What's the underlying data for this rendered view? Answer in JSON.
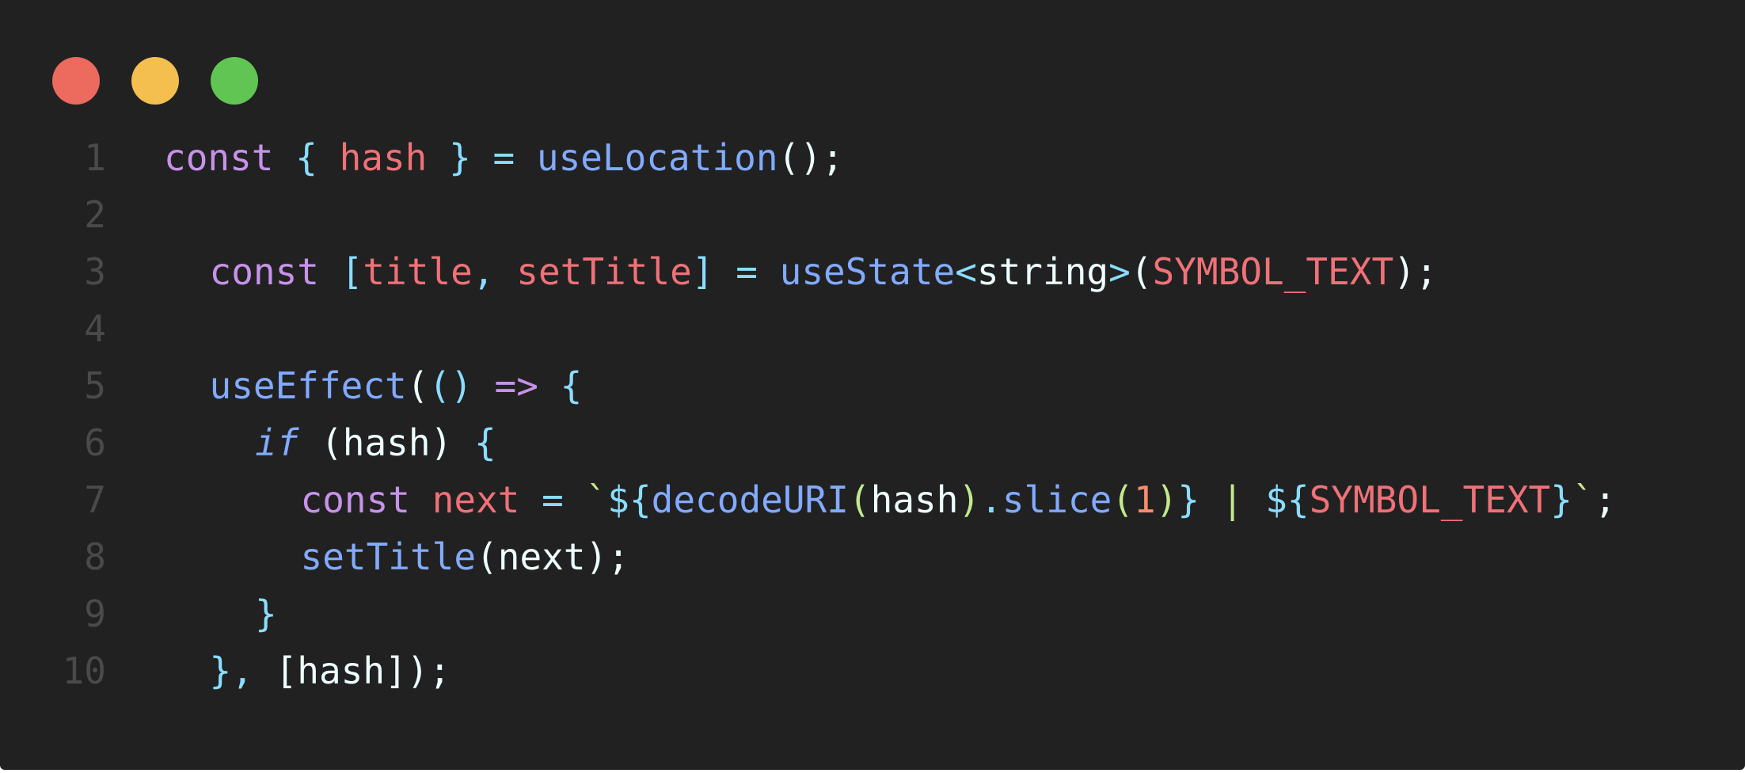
{
  "window": {
    "traffic_lights": [
      {
        "name": "close-dot",
        "color": "#ed6a5e"
      },
      {
        "name": "minimize-dot",
        "color": "#f5bf4f"
      },
      {
        "name": "maximize-dot",
        "color": "#61c554"
      }
    ]
  },
  "colors": {
    "background": "#212121",
    "keyword": "#c792ea",
    "variable": "#f07178",
    "function": "#82aaff",
    "punctuation": "#89ddff",
    "plain": "#eeffff",
    "number": "#f78c6c",
    "paren_inner": "#c3e88d",
    "line_number": "#4a4a4a"
  },
  "code": {
    "lines": [
      {
        "num": "1",
        "indent": 0,
        "tokens": [
          {
            "t": "const",
            "c": "keyword"
          },
          {
            "t": " ",
            "c": "plain"
          },
          {
            "t": "{",
            "c": "punctuation"
          },
          {
            "t": " ",
            "c": "plain"
          },
          {
            "t": "hash",
            "c": "variable"
          },
          {
            "t": " ",
            "c": "plain"
          },
          {
            "t": "}",
            "c": "punctuation"
          },
          {
            "t": " ",
            "c": "plain"
          },
          {
            "t": "=",
            "c": "punctuation"
          },
          {
            "t": " ",
            "c": "plain"
          },
          {
            "t": "useLocation",
            "c": "function"
          },
          {
            "t": "();",
            "c": "plain"
          }
        ]
      },
      {
        "num": "2",
        "indent": 0,
        "tokens": []
      },
      {
        "num": "3",
        "indent": 1,
        "tokens": [
          {
            "t": "const",
            "c": "keyword"
          },
          {
            "t": " ",
            "c": "plain"
          },
          {
            "t": "[",
            "c": "punctuation"
          },
          {
            "t": "title",
            "c": "variable"
          },
          {
            "t": ",",
            "c": "punctuation"
          },
          {
            "t": " ",
            "c": "plain"
          },
          {
            "t": "setTitle",
            "c": "variable"
          },
          {
            "t": "]",
            "c": "punctuation"
          },
          {
            "t": " ",
            "c": "plain"
          },
          {
            "t": "=",
            "c": "punctuation"
          },
          {
            "t": " ",
            "c": "plain"
          },
          {
            "t": "useState",
            "c": "function"
          },
          {
            "t": "<",
            "c": "punctuation"
          },
          {
            "t": "string",
            "c": "plain"
          },
          {
            "t": ">",
            "c": "punctuation"
          },
          {
            "t": "(",
            "c": "plain"
          },
          {
            "t": "SYMBOL_TEXT",
            "c": "variable"
          },
          {
            "t": ");",
            "c": "plain"
          }
        ]
      },
      {
        "num": "4",
        "indent": 0,
        "tokens": []
      },
      {
        "num": "5",
        "indent": 1,
        "tokens": [
          {
            "t": "useEffect",
            "c": "function"
          },
          {
            "t": "(",
            "c": "plain"
          },
          {
            "t": "()",
            "c": "punctuation"
          },
          {
            "t": " ",
            "c": "plain"
          },
          {
            "t": "=>",
            "c": "keyword"
          },
          {
            "t": " ",
            "c": "plain"
          },
          {
            "t": "{",
            "c": "punctuation"
          }
        ]
      },
      {
        "num": "6",
        "indent": 2,
        "tokens": [
          {
            "t": "if",
            "c": "function",
            "italic": true
          },
          {
            "t": " (hash) ",
            "c": "plain"
          },
          {
            "t": "{",
            "c": "punctuation"
          }
        ]
      },
      {
        "num": "7",
        "indent": 3,
        "tokens": [
          {
            "t": "const",
            "c": "keyword"
          },
          {
            "t": " ",
            "c": "plain"
          },
          {
            "t": "next",
            "c": "variable"
          },
          {
            "t": " ",
            "c": "plain"
          },
          {
            "t": "=",
            "c": "punctuation"
          },
          {
            "t": " ",
            "c": "plain"
          },
          {
            "t": "`",
            "c": "paren_inner"
          },
          {
            "t": "${",
            "c": "punctuation"
          },
          {
            "t": "decodeURI",
            "c": "function"
          },
          {
            "t": "(",
            "c": "paren_inner"
          },
          {
            "t": "hash",
            "c": "plain"
          },
          {
            "t": ")",
            "c": "paren_inner"
          },
          {
            "t": ".",
            "c": "punctuation"
          },
          {
            "t": "slice",
            "c": "function"
          },
          {
            "t": "(",
            "c": "paren_inner"
          },
          {
            "t": "1",
            "c": "number"
          },
          {
            "t": ")",
            "c": "paren_inner"
          },
          {
            "t": "}",
            "c": "punctuation"
          },
          {
            "t": " | ",
            "c": "paren_inner"
          },
          {
            "t": "${",
            "c": "punctuation"
          },
          {
            "t": "SYMBOL_TEXT",
            "c": "variable"
          },
          {
            "t": "}",
            "c": "punctuation"
          },
          {
            "t": "`",
            "c": "paren_inner"
          },
          {
            "t": ";",
            "c": "plain"
          }
        ]
      },
      {
        "num": "8",
        "indent": 3,
        "tokens": [
          {
            "t": "setTitle",
            "c": "function"
          },
          {
            "t": "(next);",
            "c": "plain"
          }
        ]
      },
      {
        "num": "9",
        "indent": 2,
        "tokens": [
          {
            "t": "}",
            "c": "punctuation"
          }
        ]
      },
      {
        "num": "10",
        "indent": 1,
        "tokens": [
          {
            "t": "}",
            "c": "punctuation"
          },
          {
            "t": ",",
            "c": "punctuation"
          },
          {
            "t": " [hash]);",
            "c": "plain"
          }
        ]
      }
    ]
  }
}
